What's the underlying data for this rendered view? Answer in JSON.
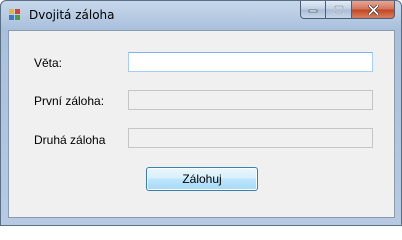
{
  "window": {
    "title": "Dvojitá záloha",
    "app_icon": "form-icon",
    "buttons": {
      "minimize": "minimize-icon",
      "maximize": "maximize-icon",
      "close": "close-icon"
    }
  },
  "form": {
    "sentence_label": "Věta:",
    "sentence_value": "",
    "first_backup_label": "První záloha:",
    "first_backup_value": "",
    "second_backup_label": "Druhá záloha",
    "second_backup_value": "",
    "backup_button_label": "Zálohuj"
  },
  "colors": {
    "close_button": "#c4431f",
    "client_background": "#f0f0f0",
    "active_field_border": "#7eb4ea",
    "button_border": "#3c7fb1"
  }
}
